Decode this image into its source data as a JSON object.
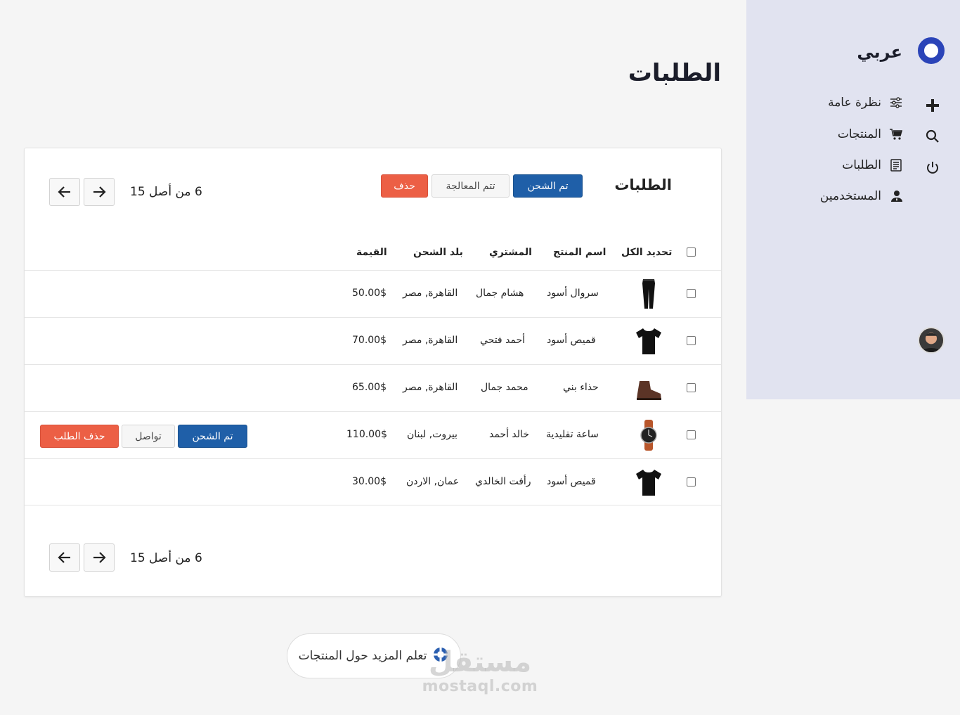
{
  "sidebar": {
    "brand": "عربي",
    "nav": [
      {
        "label": "نظرة عامة",
        "icon": "sliders-icon"
      },
      {
        "label": "المنتجات",
        "icon": "cart-icon"
      },
      {
        "label": "الطلبات",
        "icon": "document-icon"
      },
      {
        "label": "المستخدمين",
        "icon": "users-icon"
      }
    ],
    "side_icons": [
      "plus-icon",
      "search-icon",
      "power-icon"
    ]
  },
  "page": {
    "title": "الطلبات"
  },
  "card": {
    "title": "الطلبات",
    "bulk_actions": {
      "shipped": "تم الشحن",
      "processed": "تتم المعالجة",
      "delete": "حذف"
    },
    "pagination_top": "6 من أصل 15",
    "pagination_bottom": "6 من أصل 15",
    "headers": {
      "select_all": "تحديد الكل",
      "product_name": "اسم المنتج",
      "buyer": "المشتري",
      "country": "بلد الشحن",
      "value": "القيمة"
    },
    "rows": [
      {
        "product": "سروال أسود",
        "buyer": "هشام جمال",
        "country": "القاهرة, مصر",
        "value": "50.00$",
        "thumb": "pants"
      },
      {
        "product": "قميص أسود",
        "buyer": "أحمد فتحي",
        "country": "القاهرة, مصر",
        "value": "70.00$",
        "thumb": "tshirt"
      },
      {
        "product": "حذاء بني",
        "buyer": "محمد جمال",
        "country": "القاهرة, مصر",
        "value": "65.00$",
        "thumb": "boot"
      },
      {
        "product": "ساعة تقليدية",
        "buyer": "خالد أحمد",
        "country": "بيروت, لبنان",
        "value": "110.00$",
        "thumb": "watch"
      },
      {
        "product": "قميص أسود",
        "buyer": "رأفت الخالدي",
        "country": "عمان, الاردن",
        "value": "30.00$",
        "thumb": "tshirt"
      }
    ],
    "row_actions": {
      "shipped": "تم الشحن",
      "contact": "تواصل",
      "delete_order": "حذف الطلب"
    }
  },
  "learn_more": "تعلم المزيد حول المنتجات",
  "watermark": {
    "ar": "مستقل",
    "en": "mostaql.com"
  },
  "colors": {
    "primary": "#1f5fa8",
    "danger": "#ec5f45",
    "sidebar_bg": "#e1e3f0",
    "brand_ring": "#2b44b8"
  }
}
